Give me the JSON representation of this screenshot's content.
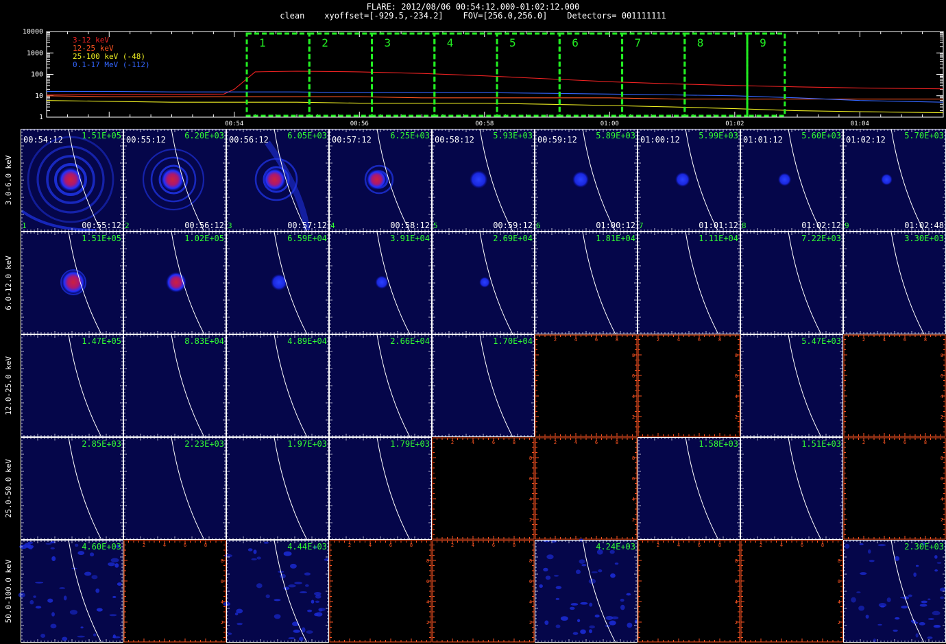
{
  "header": {
    "title": "FLARE: 2012/08/06 00:54:12.000-01:02:12.000",
    "subtitle": "clean    xyoffset=[-929.5,-234.2]    FOV=[256.0,256.0]    Detectors= 001111111"
  },
  "colors": {
    "background": "#000000",
    "image_background": "#05064a",
    "highlight_box": "#22ee22",
    "peak_label": "#33ff33",
    "empty_axis": "#ff5522",
    "limb": "#ffffff",
    "band_3_12": "#ee2222",
    "band_12_25": "#ff5522",
    "band_25_100": "#eeee22",
    "band_100k_17M": "#3366ff"
  },
  "chart_data": [
    {
      "type": "line",
      "name": "lightcurve",
      "yscale": "log",
      "ylim": [
        1,
        10000
      ],
      "ytick_labels": [
        "10000",
        "1000",
        "100",
        "10",
        "1"
      ],
      "xlim": [
        "00:51:00",
        "01:05:20"
      ],
      "xtick_labels": [
        "00:54",
        "00:56",
        "00:58",
        "01:00",
        "01:02",
        "01:04"
      ],
      "series": [
        {
          "name": "3-12 keV",
          "color": "#ee2222",
          "x": [
            "00:51:00",
            "00:53:50",
            "00:54:00",
            "00:54:20",
            "00:55:00",
            "00:56:00",
            "00:57:00",
            "00:58:00",
            "00:59:00",
            "01:00:00",
            "01:01:00",
            "01:02:00",
            "01:03:00",
            "01:04:00",
            "01:05:20"
          ],
          "values": [
            11,
            12,
            20,
            130,
            140,
            130,
            110,
            85,
            62,
            45,
            36,
            30,
            26,
            23,
            21
          ]
        },
        {
          "name": "12-25 keV",
          "color": "#ff5522",
          "x": [
            "00:51:00",
            "00:52:00",
            "00:53:00",
            "00:54:00",
            "00:55:00",
            "00:56:00",
            "00:57:00",
            "00:58:00",
            "00:59:00",
            "01:00:00",
            "01:01:00",
            "01:02:00",
            "01:03:00",
            "01:04:00",
            "01:05:20"
          ],
          "values": [
            10,
            9,
            9,
            9,
            9,
            9,
            8,
            8,
            8,
            8,
            7,
            7,
            7,
            7,
            7
          ]
        },
        {
          "name": "25-100 keV (-48)",
          "color": "#eeee22",
          "x": [
            "00:51:00",
            "00:52:00",
            "00:53:00",
            "00:54:00",
            "00:55:00",
            "00:56:00",
            "00:57:00",
            "00:58:00",
            "00:59:00",
            "01:00:00",
            "01:01:00",
            "01:02:00",
            "01:03:00",
            "01:04:00",
            "01:05:20"
          ],
          "values": [
            6,
            5.5,
            5,
            5,
            5,
            4.5,
            4.5,
            4.5,
            4,
            3.5,
            3,
            2.5,
            2,
            1.8,
            1.6
          ]
        },
        {
          "name": "0.1-17 MeV (-112)",
          "color": "#3366ff",
          "x": [
            "00:51:00",
            "00:52:00",
            "00:53:00",
            "00:54:00",
            "00:55:00",
            "00:56:00",
            "00:57:00",
            "00:58:00",
            "00:59:00",
            "01:00:00",
            "01:01:00",
            "01:02:00",
            "01:03:00",
            "01:04:00",
            "01:05:20"
          ],
          "values": [
            16,
            16,
            15,
            15,
            15,
            14,
            14,
            14,
            13,
            12,
            11,
            10,
            8,
            6,
            5
          ]
        }
      ],
      "intervals": [
        {
          "label": "1",
          "start": "00:54:12",
          "end": "00:55:12"
        },
        {
          "label": "2",
          "start": "00:55:12",
          "end": "00:56:12"
        },
        {
          "label": "3",
          "start": "00:56:12",
          "end": "00:57:12"
        },
        {
          "label": "4",
          "start": "00:57:12",
          "end": "00:58:12"
        },
        {
          "label": "5",
          "start": "00:58:12",
          "end": "00:59:12"
        },
        {
          "label": "6",
          "start": "00:59:12",
          "end": "01:00:12"
        },
        {
          "label": "7",
          "start": "01:00:12",
          "end": "01:01:12"
        },
        {
          "label": "8",
          "start": "01:01:12",
          "end": "01:02:12"
        },
        {
          "label": "9",
          "start": "01:02:12",
          "end": "01:02:48"
        }
      ]
    },
    {
      "type": "heatmap",
      "name": "image_grid",
      "energy_bands": [
        "3.0-6.0 keV",
        "6.0-12.0 keV",
        "12.0-25.0 keV",
        "25.0-50.0 keV",
        "50.0-100.0 keV"
      ],
      "start_times": [
        "00:54:12",
        "00:55:12",
        "00:56:12",
        "00:57:12",
        "00:58:12",
        "00:59:12",
        "01:00:12",
        "01:01:12",
        "01:02:12"
      ],
      "end_times": [
        "00:55:12",
        "00:56:12",
        "00:57:12",
        "00:58:12",
        "00:59:12",
        "01:00:12",
        "01:01:12",
        "01:02:12",
        "01:02:48"
      ],
      "interval_numbers": [
        "1",
        "2",
        "3",
        "4",
        "5",
        "6",
        "7",
        "8",
        "9"
      ],
      "peaks": [
        [
          "1.51E+05",
          "6.20E+03",
          "6.05E+03",
          "6.25E+03",
          "5.93E+03",
          "5.89E+03",
          "5.99E+03",
          "5.60E+03",
          "5.70E+03"
        ],
        [
          "1.51E+05",
          "1.02E+05",
          "6.59E+04",
          "3.91E+04",
          "2.69E+04",
          "1.81E+04",
          "1.11E+04",
          "7.22E+03",
          "3.30E+03"
        ],
        [
          "1.47E+05",
          "8.83E+04",
          "4.89E+04",
          "2.66E+04",
          "1.70E+04",
          null,
          null,
          "5.47E+03",
          null
        ],
        [
          "2.85E+03",
          "2.23E+03",
          "1.97E+03",
          "1.79E+03",
          null,
          null,
          "1.58E+03",
          "1.51E+03",
          null
        ],
        [
          "4.60E+03",
          null,
          "4.44E+03",
          null,
          null,
          "4.24E+03",
          null,
          null,
          "2.30E+03"
        ]
      ],
      "source_brightness": [
        [
          1.0,
          0.95,
          0.9,
          0.75,
          0.6,
          0.5,
          0.4,
          0.3,
          0.2
        ],
        [
          1.0,
          0.75,
          0.5,
          0.3,
          0.15,
          0,
          0,
          0,
          0
        ],
        [
          0,
          0,
          0,
          0,
          0,
          0,
          0,
          0,
          0
        ],
        [
          0,
          0,
          0,
          0,
          0,
          0,
          0,
          0,
          0
        ],
        [
          0,
          0,
          0,
          0,
          0,
          0,
          0,
          0,
          0
        ]
      ],
      "empty_axis_ticks": [
        "2",
        "4",
        "6",
        "8"
      ]
    }
  ]
}
